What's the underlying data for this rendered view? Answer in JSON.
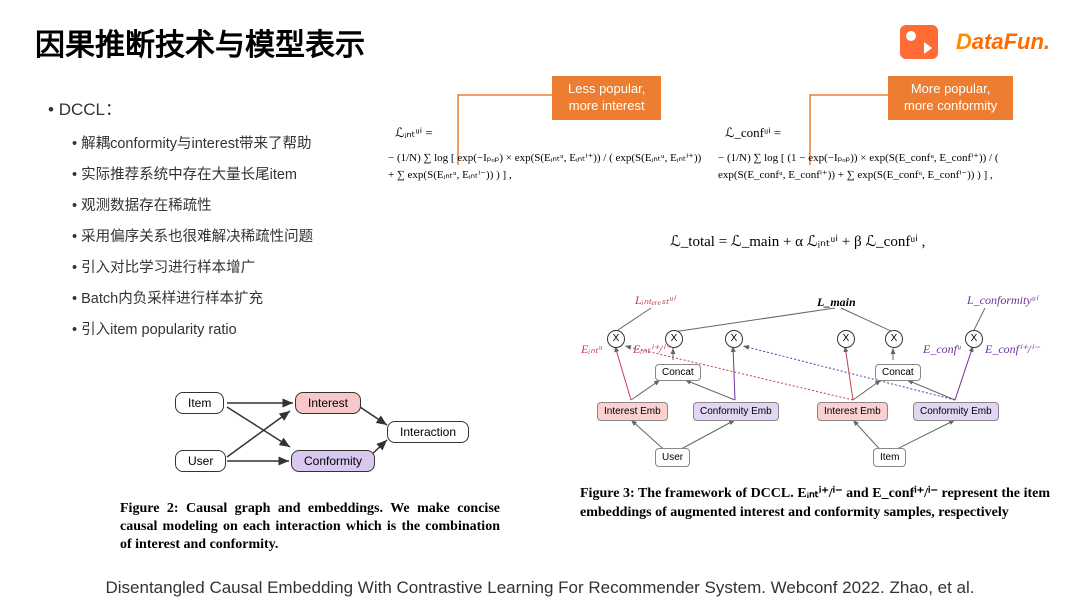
{
  "title": "因果推断技术与模型表示",
  "logo_datafun": {
    "d": "D",
    "a": "ataFun."
  },
  "bullets": {
    "root": "DCCL：",
    "items": [
      "解耦conformity与interest带来了帮助",
      "实际推荐系统中存在大量长尾item",
      "观测数据存在稀疏性",
      "采用偏序关系也很难解决稀疏性问题",
      "引入对比学习进行样本增广",
      "Batch内负采样进行样本扩充",
      "引入item popularity ratio"
    ]
  },
  "orange_boxes": {
    "left": {
      "l1": "Less popular,",
      "l2": "more interest"
    },
    "right": {
      "l1": "More popular,",
      "l2": "more conformity"
    }
  },
  "formulas": {
    "int_head": "ℒᵢₙₜᵘⁱ =",
    "int_body": "− (1/N) ∑ log [ exp(−Iₚₒₚ) × exp(S(Eᵢₙₜᵘ, Eᵢₙₜⁱ⁺)) / ( exp(S(Eᵢₙₜᵘ, Eᵢₙₜⁱ⁺)) + ∑ exp(S(Eᵢₙₜᵘ, Eᵢₙₜⁱ⁻)) ) ] ,",
    "conf_head": "ℒ_confᵘⁱ =",
    "conf_body": "− (1/N) ∑ log [ (1 − exp(−Iₚₒₚ)) × exp(S(E_confᵘ, E_confⁱ⁺)) / ( exp(S(E_confᵘ, E_confⁱ⁺)) + ∑ exp(S(E_confᵘ, E_confⁱ⁻)) ) ] ,",
    "total": "ℒ_total = ℒ_main + α ℒᵢₙₜᵘⁱ + β ℒ_confᵘⁱ ,"
  },
  "fig2": {
    "item": "Item",
    "user": "User",
    "interest": "Interest",
    "conformity": "Conformity",
    "interaction": "Interaction",
    "caption_bold": "Figure 2: Causal graph and embeddings. We make concise causal modeling on each interaction which is the combination of interest and conformity."
  },
  "fig3": {
    "labels": {
      "l_interest": "Lᵢₙₜₑᵣₑₛₜᵘⁱ",
      "l_main": "L_main",
      "l_conf": "L_conformityᵘⁱ",
      "e_int_u": "Eᵢₙₜᵘ",
      "e_int_aug": "Eᵢₙₜⁱ⁺/ⁱ⁻",
      "e_conf_u": "E_confᵘ",
      "e_conf_aug": "E_confⁱ⁺/ⁱ⁻"
    },
    "boxes": {
      "interest_emb": "Interest Emb",
      "conformity_emb": "Conformity Emb",
      "concat": "Concat",
      "user": "User",
      "item": "Item"
    },
    "caption": "Figure 3: The framework of DCCL. Eᵢₙₜⁱ⁺/ⁱ⁻ and E_confⁱ⁺/ⁱ⁻ represent the item embeddings of augmented interest and conformity samples, respectively"
  },
  "citation": "Disentangled Causal Embedding With Contrastive Learning For Recommender System. Webconf 2022. Zhao, et al."
}
